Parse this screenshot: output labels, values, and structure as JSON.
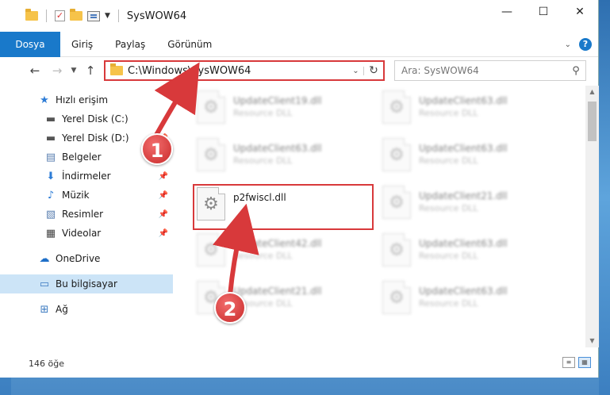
{
  "window": {
    "title": "SysWOW64",
    "controls": {
      "minimize": "—",
      "maximize": "☐",
      "close": "✕"
    }
  },
  "ribbon": {
    "tabs": [
      {
        "label": "Dosya",
        "active": true
      },
      {
        "label": "Giriş"
      },
      {
        "label": "Paylaş"
      },
      {
        "label": "Görünüm"
      }
    ],
    "help": "?"
  },
  "navigation": {
    "address": "C:\\Windows\\SysWOW64",
    "search_placeholder": "Ara: SysWOW64"
  },
  "sidebar": {
    "items": [
      {
        "label": "Hızlı erişim",
        "icon": "star-icon",
        "level": 1
      },
      {
        "label": "Yerel Disk (C:)",
        "icon": "drive-icon",
        "level": 2,
        "pinned": false
      },
      {
        "label": "Yerel Disk (D:)",
        "icon": "drive-icon",
        "level": 2,
        "pinned": true
      },
      {
        "label": "Belgeler",
        "icon": "documents-icon",
        "level": 2,
        "pinned": true
      },
      {
        "label": "İndirmeler",
        "icon": "download-icon",
        "level": 2,
        "pinned": true
      },
      {
        "label": "Müzik",
        "icon": "music-icon",
        "level": 2,
        "pinned": true
      },
      {
        "label": "Resimler",
        "icon": "pictures-icon",
        "level": 2,
        "pinned": true
      },
      {
        "label": "Videolar",
        "icon": "videos-icon",
        "level": 2,
        "pinned": true
      },
      {
        "label": "OneDrive",
        "icon": "cloud-icon",
        "level": 1
      },
      {
        "label": "Bu bilgisayar",
        "icon": "computer-icon",
        "level": 1,
        "selected": true
      },
      {
        "label": "Ağ",
        "icon": "network-icon",
        "level": 1
      }
    ]
  },
  "files": [
    {
      "name": "UpdateClient19.dll",
      "type": "Resource DLL",
      "blurred": true
    },
    {
      "name": "UpdateClient63.dll",
      "type": "Resource DLL",
      "blurred": true
    },
    {
      "name": "UpdateClient63.dll",
      "type": "Resource DLL",
      "blurred": true
    },
    {
      "name": "UpdateClient63.dll",
      "type": "Resource DLL",
      "blurred": true
    },
    {
      "name": "p2fwiscl.dll",
      "type": "",
      "blurred": false,
      "highlighted": true
    },
    {
      "name": "UpdateClient21.dll",
      "type": "Resource DLL",
      "blurred": true
    },
    {
      "name": "UpdateClient42.dll",
      "type": "Resource DLL",
      "blurred": true
    },
    {
      "name": "UpdateClient63.dll",
      "type": "Resource DLL",
      "blurred": true
    },
    {
      "name": "UpdateClient21.dll",
      "type": "Resource DLL",
      "blurred": true
    },
    {
      "name": "UpdateClient63.dll",
      "type": "Resource DLL",
      "blurred": true
    }
  ],
  "status": {
    "item_count": "146 öğe"
  },
  "annotations": {
    "step1": "1",
    "step2": "2",
    "highlight_color": "#d8393b"
  }
}
